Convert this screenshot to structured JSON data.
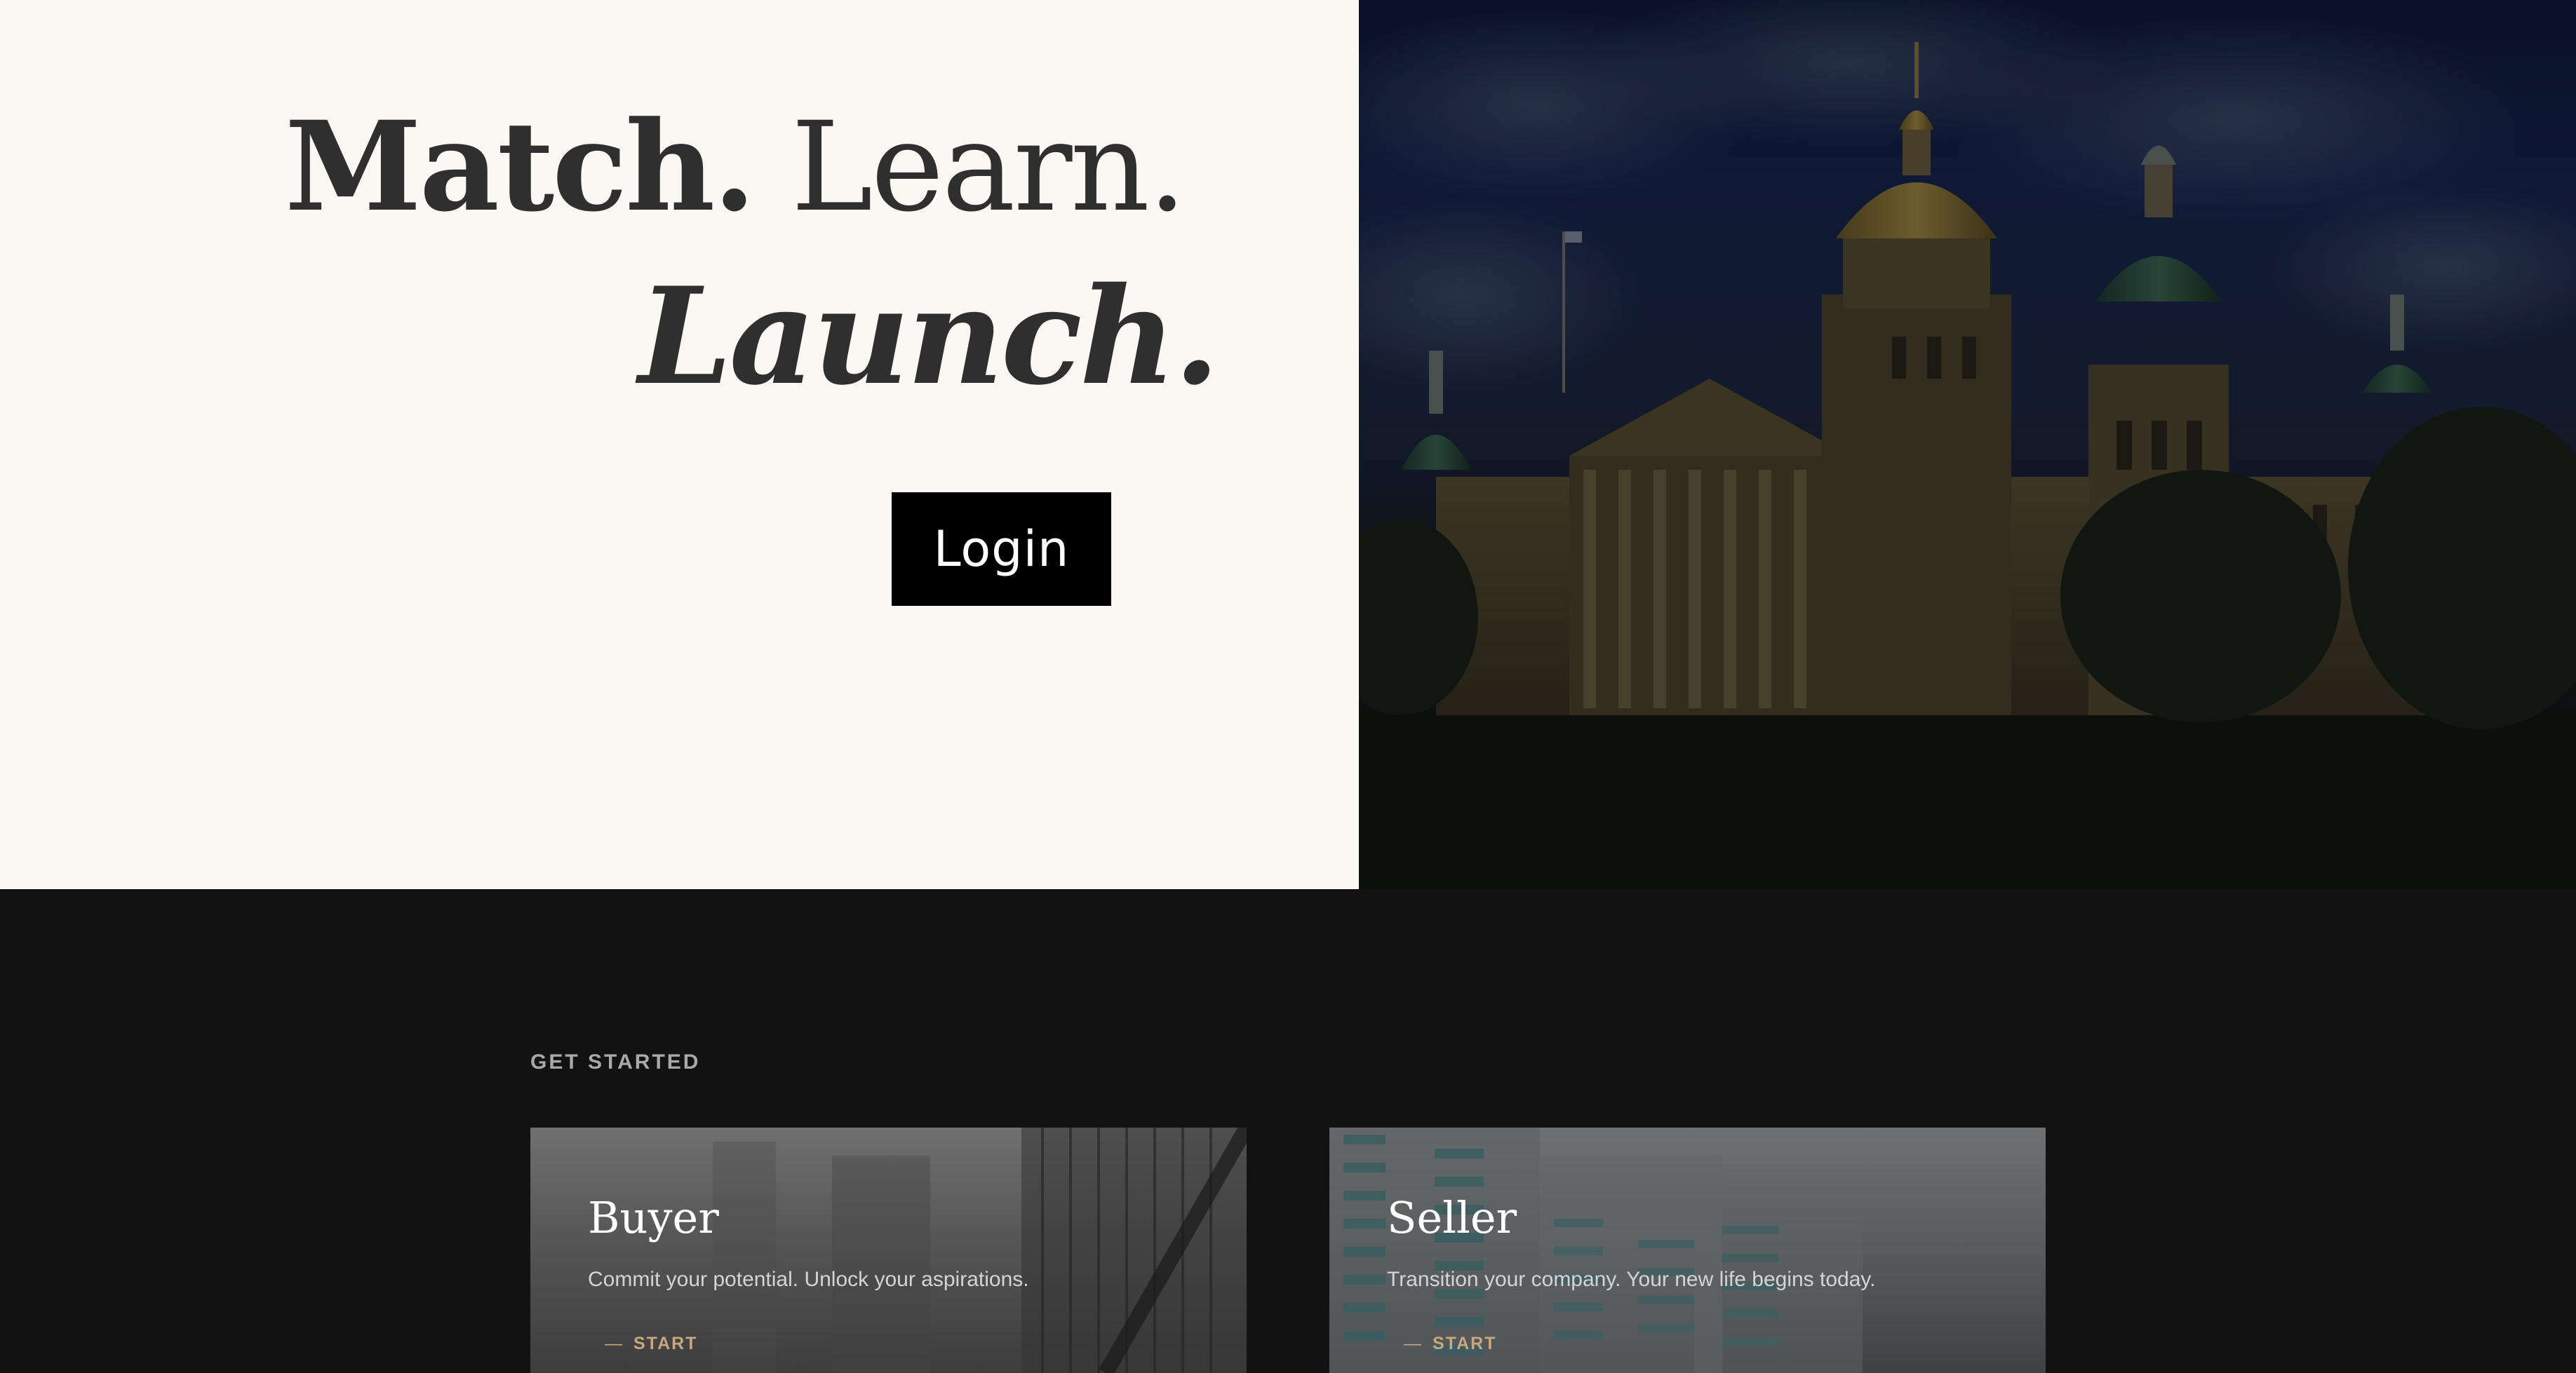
{
  "hero": {
    "headline_match": "Match.",
    "headline_learn": " Learn.",
    "headline_launch": "Launch.",
    "login_label": "Login",
    "image_subject": "capitol-building-photo"
  },
  "get_started": {
    "label": "GET STARTED",
    "cards": [
      {
        "title": "Buyer",
        "description": "Commit your potential. Unlock your aspirations.",
        "link_dash": "—",
        "link_label": "START"
      },
      {
        "title": "Seller",
        "description": "Transition your company. Your new life begins today.",
        "link_dash": "—",
        "link_label": "START"
      }
    ]
  },
  "colors": {
    "hero_background": "#fbf7f3",
    "page_background": "#121212",
    "button_background": "#000000",
    "accent": "#c8a77e"
  }
}
